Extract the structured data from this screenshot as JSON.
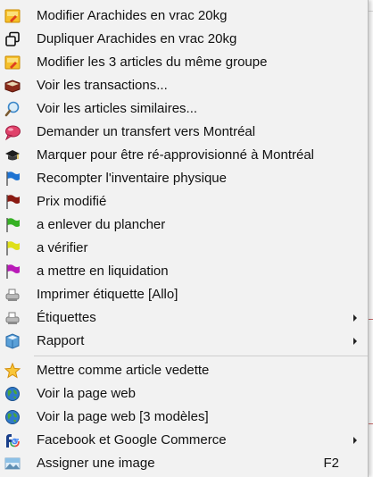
{
  "context_menu": {
    "items": [
      {
        "label": "Modifier Arachides en vrac 20kg",
        "icon": "edit-folder-icon"
      },
      {
        "label": "Dupliquer Arachides en vrac 20kg",
        "icon": "duplicate-icon"
      },
      {
        "label": "Modifier les 3 articles du même groupe",
        "icon": "edit-group-icon"
      },
      {
        "label": "Voir les transactions...",
        "icon": "book-icon"
      },
      {
        "label": "Voir les articles similaires...",
        "icon": "magnifier-icon"
      },
      {
        "label": "Demander un transfert vers Montréal",
        "icon": "speech-bubble-icon"
      },
      {
        "label": "Marquer pour être ré-approvisionné à Montréal",
        "icon": "graduation-cap-icon"
      },
      {
        "label": "Recompter l'inventaire physique",
        "icon": "blue-flag-icon"
      },
      {
        "label": "Prix modifié",
        "icon": "dark-red-flag-icon"
      },
      {
        "label": "a enlever du plancher",
        "icon": "green-flag-icon"
      },
      {
        "label": "a vérifier",
        "icon": "yellow-flag-icon"
      },
      {
        "label": "a mettre en liquidation",
        "icon": "purple-flag-icon"
      },
      {
        "label": "Imprimer étiquette [Allo]",
        "icon": "label-printer-icon"
      },
      {
        "label": "Étiquettes",
        "icon": "labels-icon",
        "submenu": true
      },
      {
        "label": "Rapport",
        "icon": "report-book-icon",
        "submenu": true
      },
      {
        "label": "Mettre comme article vedette",
        "icon": "star-icon"
      },
      {
        "label": "Voir la page web",
        "icon": "globe-icon"
      },
      {
        "label": "Voir la page web [3 modèles]",
        "icon": "globe-icon"
      },
      {
        "label": "Facebook et Google Commerce",
        "icon": "facebook-google-icon",
        "submenu": true
      },
      {
        "label": "Assigner une image",
        "icon": "image-icon",
        "shortcut": "F2"
      }
    ]
  }
}
